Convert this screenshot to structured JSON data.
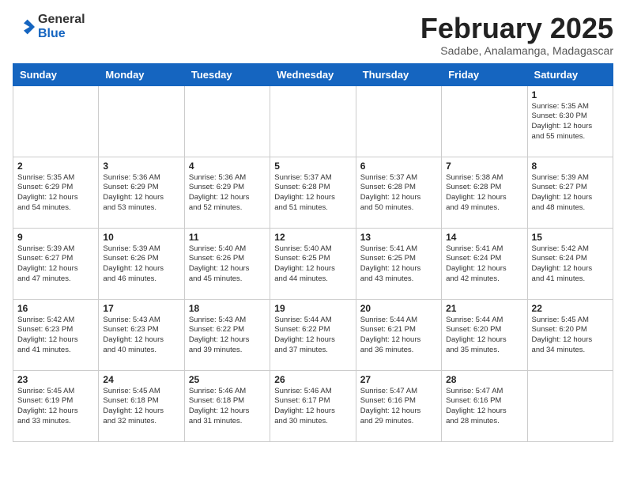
{
  "logo": {
    "general": "General",
    "blue": "Blue"
  },
  "header": {
    "month": "February 2025",
    "location": "Sadabe, Analamanga, Madagascar"
  },
  "weekdays": [
    "Sunday",
    "Monday",
    "Tuesday",
    "Wednesday",
    "Thursday",
    "Friday",
    "Saturday"
  ],
  "weeks": [
    [
      {
        "day": "",
        "info": ""
      },
      {
        "day": "",
        "info": ""
      },
      {
        "day": "",
        "info": ""
      },
      {
        "day": "",
        "info": ""
      },
      {
        "day": "",
        "info": ""
      },
      {
        "day": "",
        "info": ""
      },
      {
        "day": "1",
        "info": "Sunrise: 5:35 AM\nSunset: 6:30 PM\nDaylight: 12 hours\nand 55 minutes."
      }
    ],
    [
      {
        "day": "2",
        "info": "Sunrise: 5:35 AM\nSunset: 6:29 PM\nDaylight: 12 hours\nand 54 minutes."
      },
      {
        "day": "3",
        "info": "Sunrise: 5:36 AM\nSunset: 6:29 PM\nDaylight: 12 hours\nand 53 minutes."
      },
      {
        "day": "4",
        "info": "Sunrise: 5:36 AM\nSunset: 6:29 PM\nDaylight: 12 hours\nand 52 minutes."
      },
      {
        "day": "5",
        "info": "Sunrise: 5:37 AM\nSunset: 6:28 PM\nDaylight: 12 hours\nand 51 minutes."
      },
      {
        "day": "6",
        "info": "Sunrise: 5:37 AM\nSunset: 6:28 PM\nDaylight: 12 hours\nand 50 minutes."
      },
      {
        "day": "7",
        "info": "Sunrise: 5:38 AM\nSunset: 6:28 PM\nDaylight: 12 hours\nand 49 minutes."
      },
      {
        "day": "8",
        "info": "Sunrise: 5:39 AM\nSunset: 6:27 PM\nDaylight: 12 hours\nand 48 minutes."
      }
    ],
    [
      {
        "day": "9",
        "info": "Sunrise: 5:39 AM\nSunset: 6:27 PM\nDaylight: 12 hours\nand 47 minutes."
      },
      {
        "day": "10",
        "info": "Sunrise: 5:39 AM\nSunset: 6:26 PM\nDaylight: 12 hours\nand 46 minutes."
      },
      {
        "day": "11",
        "info": "Sunrise: 5:40 AM\nSunset: 6:26 PM\nDaylight: 12 hours\nand 45 minutes."
      },
      {
        "day": "12",
        "info": "Sunrise: 5:40 AM\nSunset: 6:25 PM\nDaylight: 12 hours\nand 44 minutes."
      },
      {
        "day": "13",
        "info": "Sunrise: 5:41 AM\nSunset: 6:25 PM\nDaylight: 12 hours\nand 43 minutes."
      },
      {
        "day": "14",
        "info": "Sunrise: 5:41 AM\nSunset: 6:24 PM\nDaylight: 12 hours\nand 42 minutes."
      },
      {
        "day": "15",
        "info": "Sunrise: 5:42 AM\nSunset: 6:24 PM\nDaylight: 12 hours\nand 41 minutes."
      }
    ],
    [
      {
        "day": "16",
        "info": "Sunrise: 5:42 AM\nSunset: 6:23 PM\nDaylight: 12 hours\nand 41 minutes."
      },
      {
        "day": "17",
        "info": "Sunrise: 5:43 AM\nSunset: 6:23 PM\nDaylight: 12 hours\nand 40 minutes."
      },
      {
        "day": "18",
        "info": "Sunrise: 5:43 AM\nSunset: 6:22 PM\nDaylight: 12 hours\nand 39 minutes."
      },
      {
        "day": "19",
        "info": "Sunrise: 5:44 AM\nSunset: 6:22 PM\nDaylight: 12 hours\nand 37 minutes."
      },
      {
        "day": "20",
        "info": "Sunrise: 5:44 AM\nSunset: 6:21 PM\nDaylight: 12 hours\nand 36 minutes."
      },
      {
        "day": "21",
        "info": "Sunrise: 5:44 AM\nSunset: 6:20 PM\nDaylight: 12 hours\nand 35 minutes."
      },
      {
        "day": "22",
        "info": "Sunrise: 5:45 AM\nSunset: 6:20 PM\nDaylight: 12 hours\nand 34 minutes."
      }
    ],
    [
      {
        "day": "23",
        "info": "Sunrise: 5:45 AM\nSunset: 6:19 PM\nDaylight: 12 hours\nand 33 minutes."
      },
      {
        "day": "24",
        "info": "Sunrise: 5:45 AM\nSunset: 6:18 PM\nDaylight: 12 hours\nand 32 minutes."
      },
      {
        "day": "25",
        "info": "Sunrise: 5:46 AM\nSunset: 6:18 PM\nDaylight: 12 hours\nand 31 minutes."
      },
      {
        "day": "26",
        "info": "Sunrise: 5:46 AM\nSunset: 6:17 PM\nDaylight: 12 hours\nand 30 minutes."
      },
      {
        "day": "27",
        "info": "Sunrise: 5:47 AM\nSunset: 6:16 PM\nDaylight: 12 hours\nand 29 minutes."
      },
      {
        "day": "28",
        "info": "Sunrise: 5:47 AM\nSunset: 6:16 PM\nDaylight: 12 hours\nand 28 minutes."
      },
      {
        "day": "",
        "info": ""
      }
    ]
  ]
}
